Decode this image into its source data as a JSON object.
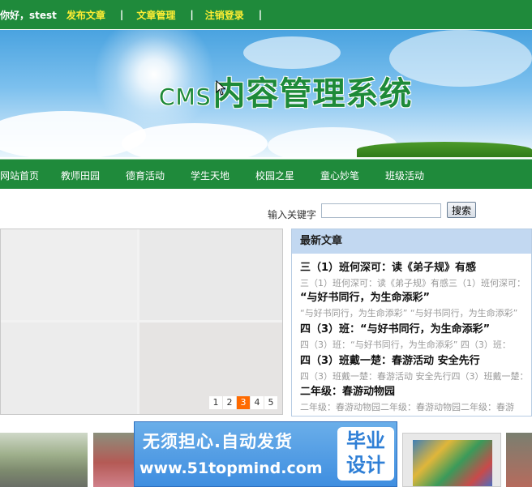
{
  "topbar": {
    "greeting": "你好，stest",
    "links": [
      "发布文章",
      "文章管理",
      "注销登录"
    ],
    "separator": "|"
  },
  "banner": {
    "title_prefix": "CMS",
    "title_main": "内容管理系统"
  },
  "nav": {
    "items": [
      "网站首页",
      "教师田园",
      "德育活动",
      "学生天地",
      "校园之星",
      "童心妙笔",
      "班级活动"
    ]
  },
  "search": {
    "label": "输入关键字",
    "value": "",
    "button": "搜索"
  },
  "slider": {
    "pages": [
      "1",
      "2",
      "3",
      "4",
      "5"
    ],
    "active_page": 3
  },
  "news": {
    "heading": "最新文章",
    "items": [
      {
        "title": "三（1）班何深可：读《弟子规》有感",
        "summary": "三（1）班何深可：读《弟子规》有感三（1）班何深可："
      },
      {
        "title": "“与好书同行，为生命添彩”",
        "summary": "“与好书同行，为生命添彩” “与好书同行，为生命添彩”"
      },
      {
        "title": "四（3）班：“与好书同行，为生命添彩”",
        "summary": "四（3）班：“与好书同行，为生命添彩” 四（3）班："
      },
      {
        "title": "四（3）班戴一楚：春游活动 安全先行",
        "summary": "四（3）班戴一楚：春游活动 安全先行四（3）班戴一楚："
      },
      {
        "title": "二年级：春游动物园",
        "summary": "二年级：春游动物园二年级：春游动物园二年级：春游"
      }
    ]
  },
  "ad": {
    "line1": "无须担心.自动发货",
    "line2": "www.51topmind.com",
    "badge_top": "毕业",
    "badge_bottom": "设计"
  },
  "colors": {
    "green": "#1f8a3b",
    "link_yellow": "#ffee33",
    "pager_active": "#ff6a00",
    "news_head": "#c2d8f1"
  }
}
